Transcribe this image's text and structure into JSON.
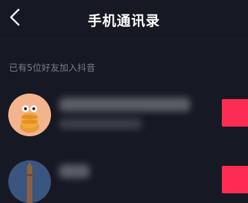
{
  "header": {
    "title": "手机通讯录",
    "back_icon": "chevron-left-icon"
  },
  "section_label": "已有5位好友加入抖音",
  "contacts": [
    {
      "avatar": "cartoon-avatar-icon",
      "name_visible": false
    },
    {
      "avatar": "tower-photo-avatar",
      "name_visible": false
    }
  ],
  "colors": {
    "background": "#161823",
    "follow_button": "#fe2c55",
    "secondary_text": "#7d7f88"
  }
}
